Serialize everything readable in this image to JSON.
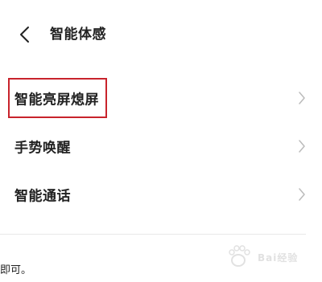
{
  "header": {
    "back_icon": "chevron-left-icon",
    "title": "智能体感"
  },
  "menu": {
    "items": [
      {
        "label": "智能亮屏熄屏",
        "icon": "chevron-right-icon",
        "highlighted": true
      },
      {
        "label": "手势唤醒",
        "icon": "chevron-right-icon",
        "highlighted": false
      },
      {
        "label": "智能通话",
        "icon": "chevron-right-icon",
        "highlighted": false
      }
    ]
  },
  "annotation": {
    "highlight_color": "#c8232c"
  },
  "footer": {
    "text": "即可。"
  },
  "watermark": {
    "text": "Bai经验"
  },
  "colors": {
    "background": "#ffffff",
    "text": "#222222",
    "chevron": "#bbbbbb",
    "divider": "#e8e8e8"
  }
}
